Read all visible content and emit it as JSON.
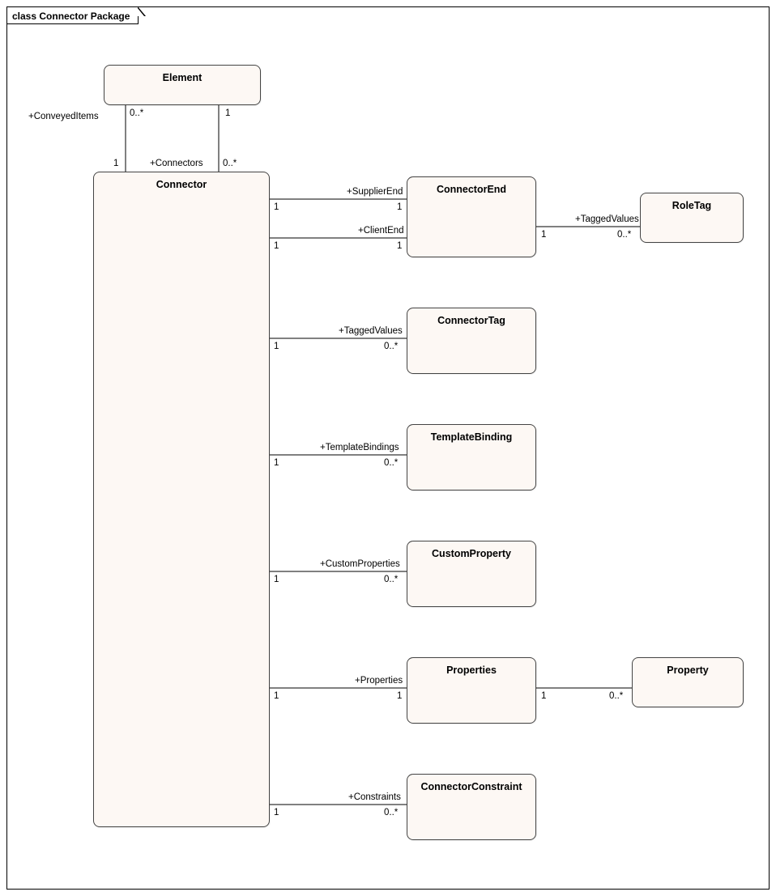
{
  "frame_title": "class Connector Package",
  "classes": {
    "element": "Element",
    "connector": "Connector",
    "connectorEnd": "ConnectorEnd",
    "roleTag": "RoleTag",
    "connectorTag": "ConnectorTag",
    "templateBinding": "TemplateBinding",
    "customProperty": "CustomProperty",
    "properties": "Properties",
    "property": "Property",
    "connectorConstraint": "ConnectorConstraint"
  },
  "labels": {
    "conveyedItems": "+ConveyedItems",
    "connectors": "+Connectors",
    "supplierEnd": "+SupplierEnd",
    "clientEnd": "+ClientEnd",
    "taggedValues": "+TaggedValues",
    "templateBindings": "+TemplateBindings",
    "customProperties": "+CustomProperties",
    "propertiesRole": "+Properties",
    "constraints": "+Constraints"
  },
  "mult": {
    "one": "1",
    "zeroMany": "0..*"
  }
}
